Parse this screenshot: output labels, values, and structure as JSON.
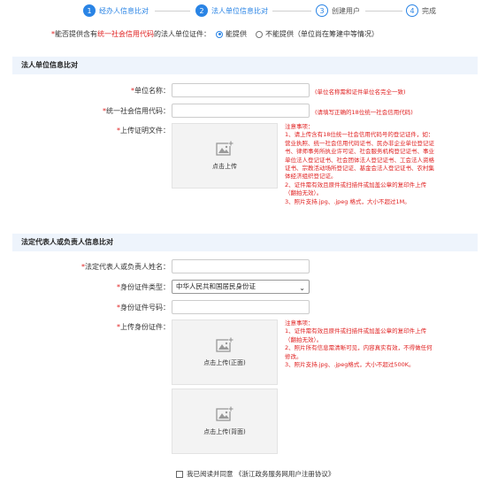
{
  "steps": [
    {
      "num": "1",
      "label": "经办人信息比对"
    },
    {
      "num": "2",
      "label": "法人单位信息比对"
    },
    {
      "num": "3",
      "label": "创建用户"
    },
    {
      "num": "4",
      "label": "完成"
    }
  ],
  "question": {
    "required_mark": "*",
    "pre": "能否提供含有",
    "highlight": "统一社会信用代码",
    "post": "的法人单位证件：",
    "option_yes": "能提供",
    "option_no": "不能提供（单位尚在筹建中等情况）",
    "selected": "yes"
  },
  "section1": {
    "title": "法人单位信息比对",
    "unit_name_label": "单位名称：",
    "unit_name_hint": "(单位名称需和证件单位名完全一致)",
    "credit_code_label": "统一社会信用代码：",
    "credit_code_hint": "(请填写正确的18位统一社会信用代码)",
    "upload_label": "上传证明文件：",
    "upload_text": "点击上传",
    "notes": "注意事项：\n1、请上传含有18位统一社会信用代码号的登记证件，如：营业执照、统一社会信用代码证书、民办非企业单位登记证书、律师事务所执业许可证、社会服务机构登记证书、事业单位法人登记证书、社会团体法人登记证书、工会法人资格证书、宗教活动场所登记证、基金会法人登记证书、农村集体经济组织登记证。\n2、证件需有效且原件或扫描件或加盖公章的复印件上传（翻拍无效）。\n3、照片支持.jpg、.jpeg 格式，大小不超过1M。"
  },
  "section2": {
    "title": "法定代表人或负责人信息比对",
    "rep_name_label": "法定代表人或负责人姓名：",
    "id_type_label": "身份证件类型：",
    "id_type_value": "中华人民共和国居民身份证",
    "id_number_label": "身份证件号码：",
    "id_upload_label": "上传身份证件：",
    "upload_front": "点击上传(正面)",
    "upload_back": "点击上传(背面)",
    "notes": "注意事项：\n1、证件需有效且原件或扫描件或加盖公章的复印件上传（翻拍无效）。\n2、照片所有信息需清晰可见，内容真实有效，不得做任何修改。\n3、照片支持.jpg、.jpeg格式，大小不超过500K。"
  },
  "agreement": {
    "text": "我已阅读并同意 《浙江政务服务网用户注册协议》"
  },
  "colors": {
    "accent": "#2a84e5",
    "required": "#e02020",
    "section_bg": "#eef4fc"
  }
}
